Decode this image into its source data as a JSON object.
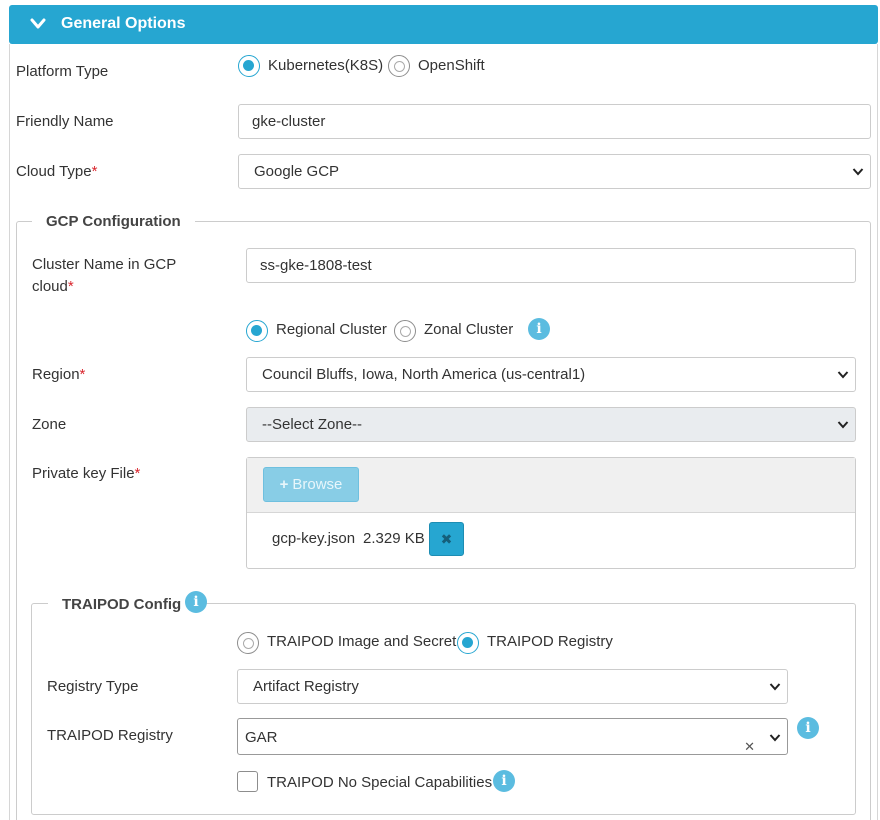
{
  "header": {
    "title": "General Options",
    "toggle_icon": "chevron-down-icon"
  },
  "colors": {
    "accent": "#26a6d1",
    "required": "#d9262e",
    "info": "#5bbce0"
  },
  "general": {
    "platform_type_label": "Platform Type",
    "platform_options": [
      "Kubernetes(K8S)",
      "OpenShift"
    ],
    "platform_selected": "Kubernetes(K8S)",
    "friendly_name_label": "Friendly Name",
    "friendly_name_value": "gke-cluster",
    "cloud_type_label": "Cloud Type",
    "cloud_type_value": "Google GCP",
    "required_mark": "*"
  },
  "gcp": {
    "legend": "GCP Configuration",
    "cluster_name_label_1": "Cluster Name in GCP",
    "cluster_name_label_2": "cloud",
    "cluster_name_value": "ss-gke-1808-test",
    "cluster_scope_options": [
      "Regional Cluster",
      "Zonal Cluster"
    ],
    "cluster_scope_selected": "Regional Cluster",
    "region_label": "Region",
    "region_value": "Council Bluffs, Iowa, North America (us-central1)",
    "zone_label": "Zone",
    "zone_value": "--Select Zone--",
    "key_file_label": "Private key File",
    "browse_label": "Browse",
    "file_name": "gcp-key.json",
    "file_size": "2.329 KB"
  },
  "traipod": {
    "legend": "TRAIPOD Config",
    "source_options": [
      "TRAIPOD Image and Secret",
      "TRAIPOD Registry"
    ],
    "source_selected": "TRAIPOD Registry",
    "registry_type_label": "Registry Type",
    "registry_type_value": "Artifact Registry",
    "registry_label": "TRAIPOD Registry",
    "registry_value": "GAR",
    "no_special_caps_label": "TRAIPOD No Special Capabilities",
    "no_special_caps_checked": false
  }
}
